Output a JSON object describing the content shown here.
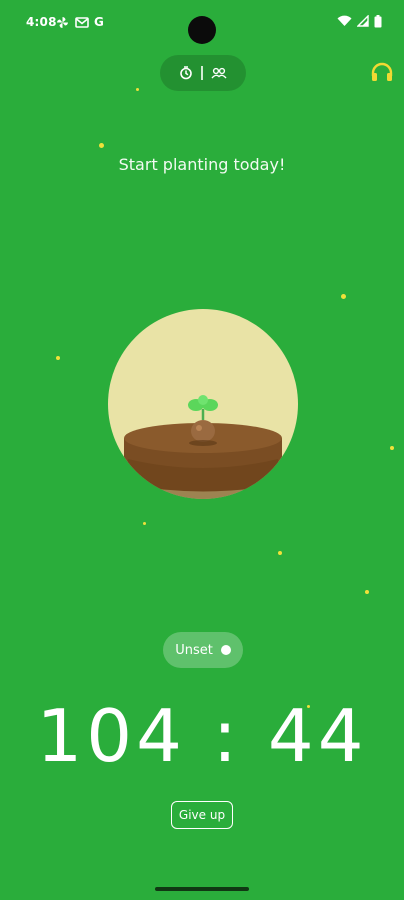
{
  "status_bar": {
    "time": "4:08",
    "notification_icons": [
      "pinwheel-icon",
      "gmail-icon",
      "google-icon"
    ],
    "google_glyph": "G",
    "system_icons": [
      "wifi-icon",
      "signal-icon",
      "battery-icon"
    ]
  },
  "header": {
    "mode_icons": [
      "single-mode-icon",
      "together-mode-icon"
    ],
    "headphone_icon": "headphones-icon",
    "accent_color": "#f1d933"
  },
  "main": {
    "headline": "Start planting today!",
    "tree_stage": "sprout",
    "tag_label": "Unset",
    "timer": "104 : 44",
    "give_up_label": "Give up"
  },
  "colors": {
    "background": "#2aad3b",
    "circle": "#e9e3a6",
    "soil": "#7a4d23",
    "leaf": "#5bd65b"
  }
}
